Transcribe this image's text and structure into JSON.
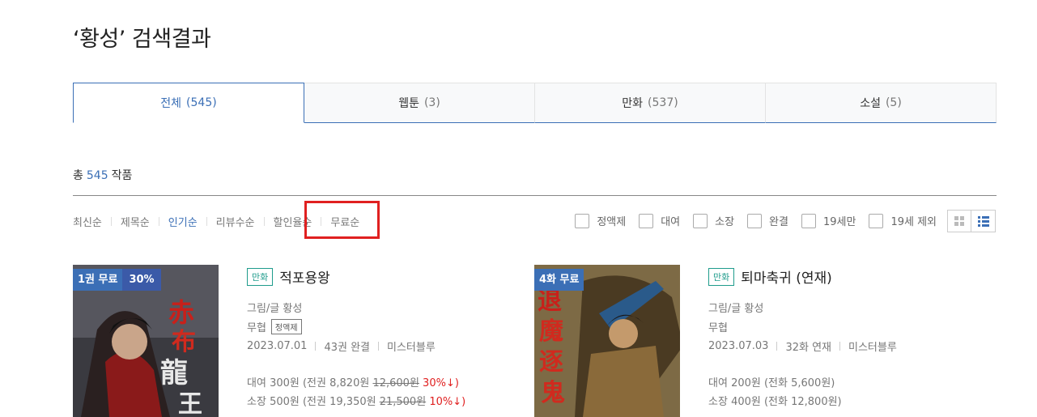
{
  "title": "‘황성’ 검색결과",
  "tabs": [
    {
      "label": "전체",
      "count": "(545)"
    },
    {
      "label": "웹툰",
      "count": "(3)"
    },
    {
      "label": "만화",
      "count": "(537)"
    },
    {
      "label": "소설",
      "count": "(5)"
    }
  ],
  "total": {
    "prefix": "총",
    "count": "545",
    "suffix": "작품"
  },
  "sorts": [
    "최신순",
    "제목순",
    "인기순",
    "리뷰수순",
    "할인율순",
    "무료순"
  ],
  "filters": [
    "정액제",
    "대여",
    "소장",
    "완결",
    "19세만",
    "19세 제외"
  ],
  "view_icons": [
    "grid-view-icon",
    "list-view-icon"
  ],
  "accent_color": "#3b6fb6",
  "books": [
    {
      "badge": "1권 무료",
      "badge_pct": "30%",
      "genre": "만화",
      "title": "적포용왕",
      "author": "그림/글 황성",
      "category": "무협",
      "tag": "정액제",
      "date": "2023.07.01",
      "volumes": "43권 완결",
      "publisher": "미스터블루",
      "rent_label": "대여",
      "rent_price": "300원",
      "rent_total_prefix": "(전권",
      "rent_total": "8,820원",
      "rent_orig": "12,600원",
      "rent_disc": "30%↓)",
      "own_label": "소장",
      "own_price": "500원",
      "own_total_prefix": "(전권",
      "own_total": "19,350원",
      "own_orig": "21,500원",
      "own_disc": "10%↓)"
    },
    {
      "badge": "4화 무료",
      "genre": "만화",
      "title": "퇴마축귀 (연재)",
      "author": "그림/글 황성",
      "category": "무협",
      "date": "2023.07.03",
      "volumes": "32화 연재",
      "publisher": "미스터블루",
      "rent_label": "대여",
      "rent_price": "200원",
      "rent_total": "(전화 5,600원)",
      "own_label": "소장",
      "own_price": "400원",
      "own_total": "(전화 12,800원)"
    }
  ]
}
